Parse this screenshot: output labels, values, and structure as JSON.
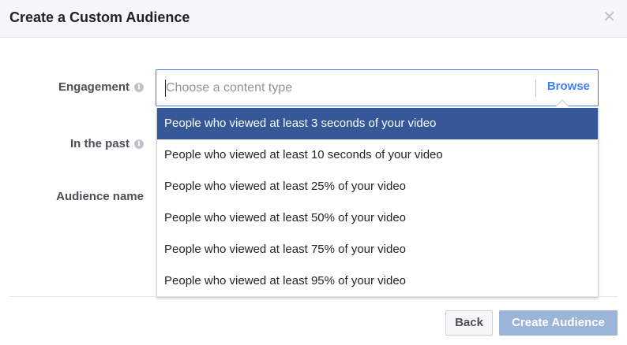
{
  "dialog": {
    "title": "Create a Custom Audience",
    "close_icon": "close-icon"
  },
  "form": {
    "engagement_label": "Engagement",
    "past_label": "In the past",
    "audience_name_label": "Audience name",
    "info_glyph": "i"
  },
  "content_type": {
    "placeholder": "Choose a content type",
    "value": "",
    "browse_label": "Browse"
  },
  "dropdown": {
    "selected_index": 0,
    "options": [
      "People who viewed at least 3 seconds of your video",
      "People who viewed at least 10 seconds of your video",
      "People who viewed at least 25% of your video",
      "People who viewed at least 50% of your video",
      "People who viewed at least 75% of your video",
      "People who viewed at least 95% of your video"
    ]
  },
  "footer": {
    "back_label": "Back",
    "create_label": "Create Audience"
  },
  "colors": {
    "accent": "#4080ff",
    "selected_bg": "#365899",
    "disabled_primary": "#9cb4d8"
  }
}
